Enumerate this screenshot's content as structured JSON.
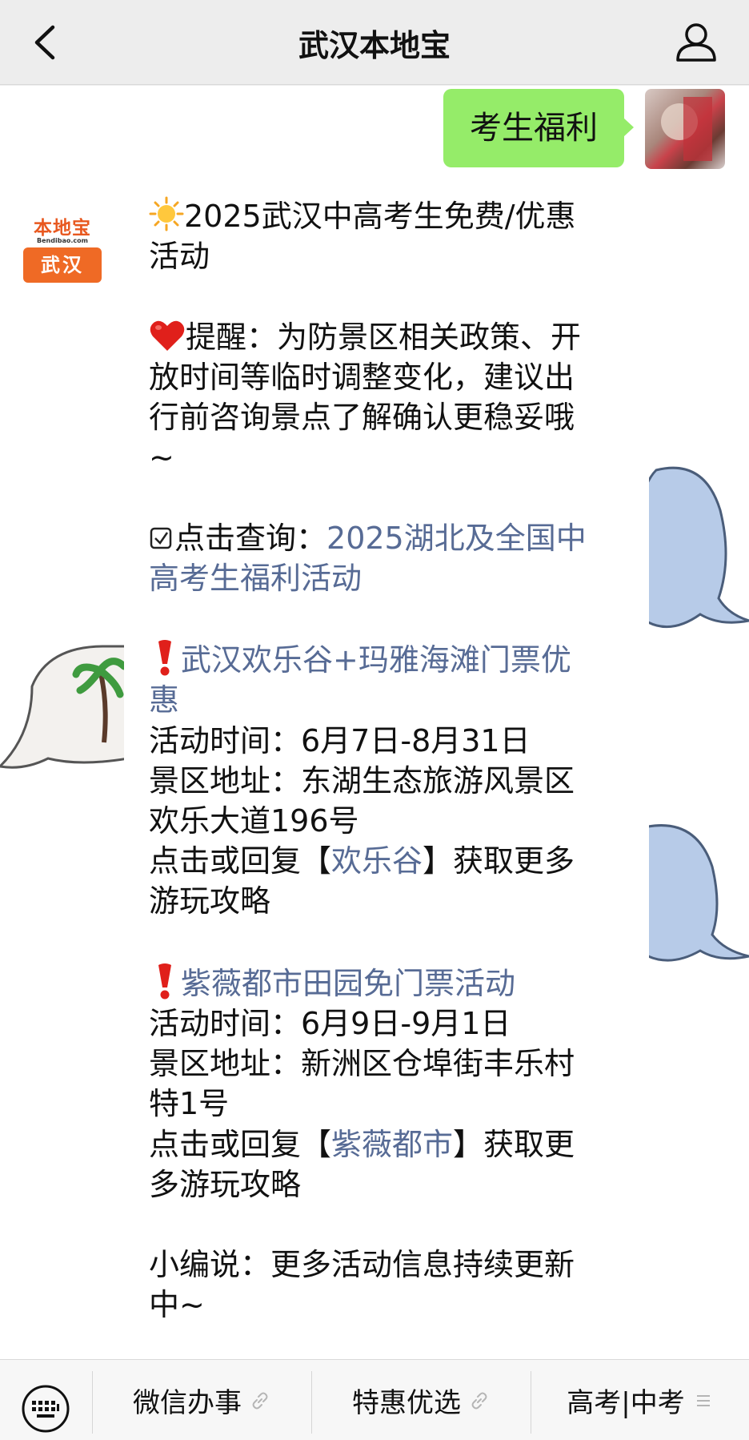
{
  "header": {
    "title": "武汉本地宝"
  },
  "user_message": {
    "text": "考生福利"
  },
  "bot_avatar": {
    "logo_top": "本地宝",
    "logo_sub": "Bendibao.com",
    "logo_city": "武汉"
  },
  "message": {
    "title_line1": "2025武汉中高考生免费/优惠",
    "title_line2": "活动",
    "reminder_line1": "提醒：为防景区相关政策、开",
    "reminder_line2": "放时间等临时调整变化，建议出",
    "reminder_line3": "行前咨询景点了解确认更稳妥哦",
    "reminder_line4": "~",
    "query_prefix": "点击查询：",
    "query_link_line1": "2025湖北及全国中",
    "query_link_line2": "高考生福利活动",
    "item1_title_line1": "武汉欢乐谷+玛雅海滩门票优",
    "item1_title_line2": "惠",
    "item1_time": "活动时间：6月7日-8月31日",
    "item1_addr_line1": "景区地址：东湖生态旅游风景区",
    "item1_addr_line2": "欢乐大道196号",
    "item1_more_prefix": "点击或回复【",
    "item1_more_link": "欢乐谷",
    "item1_more_suffix": "】获取更多",
    "item1_more_line2": "游玩攻略",
    "item2_title": "紫薇都市田园免门票活动",
    "item2_time": "活动时间：6月9日-9月1日",
    "item2_addr_line1": "景区地址：新洲区仓埠街丰乐村",
    "item2_addr_line2": "特1号",
    "item2_more_prefix": "点击或回复【",
    "item2_more_link": "紫薇都市",
    "item2_more_suffix": "】获取更",
    "item2_more_line2": "多游玩攻略",
    "footer_line1": "小编说：更多活动信息持续更新",
    "footer_line2": "中~"
  },
  "bottom_menu": {
    "items": [
      {
        "label": "微信办事",
        "icon": "link-icon"
      },
      {
        "label": "特惠优选",
        "icon": "link-icon"
      },
      {
        "label": "高考|中考",
        "icon": "menu-lines-icon"
      }
    ]
  },
  "colors": {
    "bubble_green": "#95ec69",
    "link_blue": "#576b95",
    "brand_orange": "#ef6a25",
    "background_gray": "#ededed"
  }
}
